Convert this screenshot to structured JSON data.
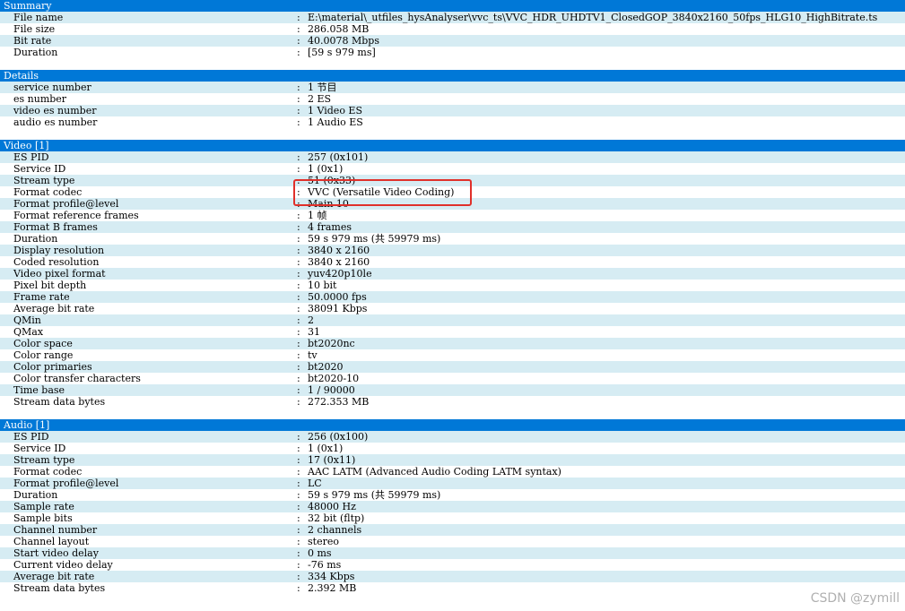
{
  "sections": [
    {
      "title": "Summary",
      "rows": [
        {
          "label": "File name",
          "value": "E:\\material\\_utfiles_hysAnalyser\\vvc_ts\\VVC_HDR_UHDTV1_ClosedGOP_3840x2160_50fps_HLG10_HighBitrate.ts"
        },
        {
          "label": "File size",
          "value": "286.058 MB"
        },
        {
          "label": "Bit rate",
          "value": "40.0078 Mbps"
        },
        {
          "label": "Duration",
          "value": "[59 s 979 ms]"
        }
      ]
    },
    {
      "title": "Details",
      "rows": [
        {
          "label": "service number",
          "value": "1 节目"
        },
        {
          "label": "es number",
          "value": "2 ES"
        },
        {
          "label": "video es number",
          "value": "1 Video ES"
        },
        {
          "label": "audio es number",
          "value": "1 Audio ES"
        }
      ]
    },
    {
      "title": "Video [1]",
      "rows": [
        {
          "label": "ES PID",
          "value": "257 (0x101)"
        },
        {
          "label": "Service ID",
          "value": "1 (0x1)"
        },
        {
          "label": "Stream type",
          "value": "51 (0x33)"
        },
        {
          "label": "Format codec",
          "value": "VVC (Versatile Video Coding)"
        },
        {
          "label": "Format profile@level",
          "value": "Main 10"
        },
        {
          "label": "Format reference frames",
          "value": "1 帧"
        },
        {
          "label": "Format B frames",
          "value": "4 frames"
        },
        {
          "label": "Duration",
          "value": "59 s 979 ms (共 59979 ms)"
        },
        {
          "label": "Display resolution",
          "value": "3840 x 2160"
        },
        {
          "label": "Coded resolution",
          "value": "3840 x 2160"
        },
        {
          "label": "Video pixel format",
          "value": "yuv420p10le"
        },
        {
          "label": "Pixel bit depth",
          "value": "10 bit"
        },
        {
          "label": "Frame rate",
          "value": "50.0000 fps"
        },
        {
          "label": "Average bit rate",
          "value": "38091 Kbps"
        },
        {
          "label": "QMin",
          "value": "2"
        },
        {
          "label": "QMax",
          "value": "31"
        },
        {
          "label": "Color space",
          "value": "bt2020nc"
        },
        {
          "label": "Color range",
          "value": "tv"
        },
        {
          "label": "Color primaries",
          "value": "bt2020"
        },
        {
          "label": "Color transfer characters",
          "value": "bt2020-10"
        },
        {
          "label": "Time base",
          "value": "1 / 90000"
        },
        {
          "label": "Stream data bytes",
          "value": "272.353 MB"
        }
      ]
    },
    {
      "title": "Audio [1]",
      "rows": [
        {
          "label": "ES PID",
          "value": "256 (0x100)"
        },
        {
          "label": "Service ID",
          "value": "1 (0x1)"
        },
        {
          "label": "Stream type",
          "value": "17 (0x11)"
        },
        {
          "label": "Format codec",
          "value": "AAC LATM (Advanced Audio Coding LATM syntax)"
        },
        {
          "label": "Format profile@level",
          "value": "LC"
        },
        {
          "label": "Duration",
          "value": "59 s 979 ms (共 59979 ms)"
        },
        {
          "label": "Sample rate",
          "value": "48000 Hz"
        },
        {
          "label": "Sample bits",
          "value": "32 bit (fltp)"
        },
        {
          "label": "Channel number",
          "value": "2 channels"
        },
        {
          "label": "Channel layout",
          "value": "stereo"
        },
        {
          "label": "Start video delay",
          "value": "0 ms"
        },
        {
          "label": "Current video delay",
          "value": "-76 ms"
        },
        {
          "label": "Average bit rate",
          "value": "334 Kbps"
        },
        {
          "label": "Stream data bytes",
          "value": "2.392 MB"
        }
      ]
    }
  ],
  "separator": ":",
  "watermark": "CSDN @zymill",
  "colors": {
    "header": "#0078d7",
    "stripe": "#d6ecf3",
    "highlight": "#e0302a"
  }
}
